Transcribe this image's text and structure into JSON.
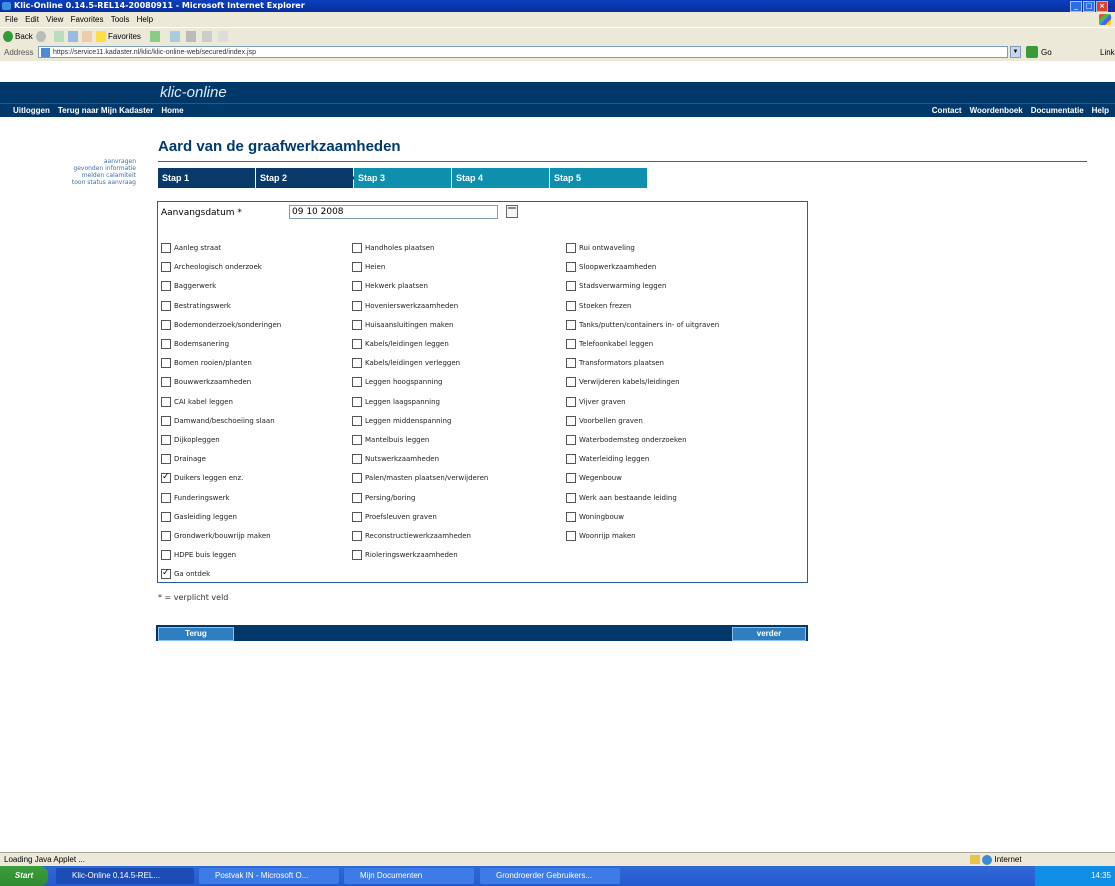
{
  "window": {
    "title": "Klic-Online 0.14.5-REL14-20080911 - Microsoft Internet Explorer"
  },
  "menu": [
    "File",
    "Edit",
    "View",
    "Favorites",
    "Tools",
    "Help"
  ],
  "toolbar": {
    "back": "Back",
    "favorites": "Favorites"
  },
  "address": {
    "label": "Address",
    "url": "https://service11.kadaster.nl/klic/klic-online-web/secured/index.jsp",
    "go": "Go",
    "links": "Links"
  },
  "brand": "klic-online",
  "nav": {
    "left": [
      "Uitloggen",
      "Terug naar Mijn Kadaster",
      "Home"
    ],
    "right": [
      "Contact",
      "Woordenboek",
      "Documentatie",
      "Help"
    ]
  },
  "sidebar": [
    "aanvragen",
    "gevonden informatie",
    "melden calamiteit",
    "toon status aanvraag"
  ],
  "page": {
    "title": "Aard van de graafwerkzaamheden"
  },
  "steps": [
    "Stap 1",
    "Stap 2",
    "Stap 3",
    "Stap 4",
    "Stap 5"
  ],
  "form": {
    "date_label": "Aanvangsdatum *",
    "date_value": "09 10 2008",
    "col1": [
      {
        "label": "Aanleg straat",
        "checked": false
      },
      {
        "label": "Archeologisch onderzoek",
        "checked": false
      },
      {
        "label": "Baggerwerk",
        "checked": false
      },
      {
        "label": "Bestratingswerk",
        "checked": false
      },
      {
        "label": "Bodemonderzoek/sonderingen",
        "checked": false
      },
      {
        "label": "Bodemsanering",
        "checked": false
      },
      {
        "label": "Bomen rooien/planten",
        "checked": false
      },
      {
        "label": "Bouwwerkzaamheden",
        "checked": false
      },
      {
        "label": "CAI kabel leggen",
        "checked": false
      },
      {
        "label": "Damwand/beschoeiing slaan",
        "checked": false
      },
      {
        "label": "Dijkopleggen",
        "checked": false
      },
      {
        "label": "Drainage",
        "checked": false
      },
      {
        "label": "Duikers leggen enz.",
        "checked": true
      },
      {
        "label": "Funderingswerk",
        "checked": false
      },
      {
        "label": "Gasleiding leggen",
        "checked": false
      },
      {
        "label": "Grondwerk/bouwrijp maken",
        "checked": false
      },
      {
        "label": "HDPE buis leggen",
        "checked": false
      },
      {
        "label": "Ga ontdek",
        "checked": true
      }
    ],
    "col2": [
      {
        "label": "Handholes plaatsen",
        "checked": false
      },
      {
        "label": "Heien",
        "checked": false
      },
      {
        "label": "Hekwerk plaatsen",
        "checked": false
      },
      {
        "label": "Hovenierswerkzaamheden",
        "checked": false
      },
      {
        "label": "Huisaansluitingen maken",
        "checked": false
      },
      {
        "label": "Kabels/leidingen leggen",
        "checked": false
      },
      {
        "label": "Kabels/leidingen verleggen",
        "checked": false
      },
      {
        "label": "Leggen hoogspanning",
        "checked": false
      },
      {
        "label": "Leggen laagspanning",
        "checked": false
      },
      {
        "label": "Leggen middenspanning",
        "checked": false
      },
      {
        "label": "Mantelbuis leggen",
        "checked": false
      },
      {
        "label": "Nutswerkzaamheden",
        "checked": false
      },
      {
        "label": "Palen/masten plaatsen/verwijderen",
        "checked": false
      },
      {
        "label": "Persing/boring",
        "checked": false
      },
      {
        "label": "Proefsleuven graven",
        "checked": false
      },
      {
        "label": "Reconstructiewerkzaamheden",
        "checked": false
      },
      {
        "label": "Rioleringswerkzaamheden",
        "checked": false
      }
    ],
    "col3": [
      {
        "label": "Rui ontwaveling",
        "checked": false
      },
      {
        "label": "Sloopwerkzaamheden",
        "checked": false
      },
      {
        "label": "Stadsverwarming leggen",
        "checked": false
      },
      {
        "label": "Stoeken frezen",
        "checked": false
      },
      {
        "label": "Tanks/putten/containers in- of uitgraven",
        "checked": false
      },
      {
        "label": "Telefoonkabel leggen",
        "checked": false
      },
      {
        "label": "Transformators plaatsen",
        "checked": false
      },
      {
        "label": "Verwijderen kabels/leidingen",
        "checked": false
      },
      {
        "label": "Vijver graven",
        "checked": false
      },
      {
        "label": "Voorbellen graven",
        "checked": false
      },
      {
        "label": "Waterbodemsteg onderzoeken",
        "checked": false
      },
      {
        "label": "Waterleiding leggen",
        "checked": false
      },
      {
        "label": "Wegenbouw",
        "checked": false
      },
      {
        "label": "Werk aan bestaande leiding",
        "checked": false
      },
      {
        "label": "Woningbouw",
        "checked": false
      },
      {
        "label": "Woonrijp maken",
        "checked": false
      }
    ],
    "required_note": "* = verplicht veld",
    "back_btn": "Terug",
    "next_btn": "verder"
  },
  "status": {
    "text": "Loading Java Applet ...",
    "zone": "Internet"
  },
  "taskbar": {
    "start": "Start",
    "tasks": [
      "Klic-Online 0.14.5-REL...",
      "Postvak IN - Microsoft O...",
      "Mijn Documenten",
      "Grondroerder Gebruikers..."
    ],
    "clock": "14:35"
  },
  "colors": {
    "header": "#00386a",
    "step_active": "#0a3a6a",
    "step_inactive": "#0f8fae",
    "title": "#003a70"
  }
}
